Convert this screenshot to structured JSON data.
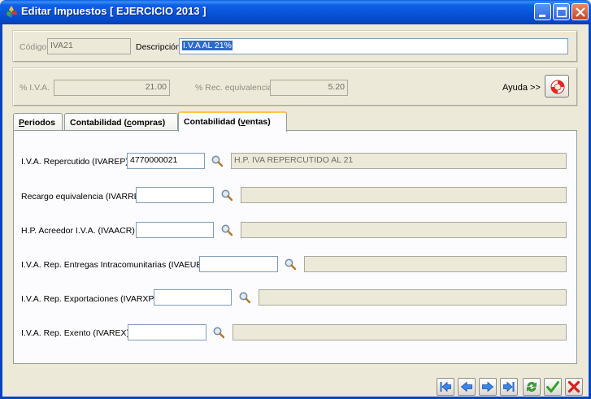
{
  "window": {
    "title": "Editar Impuestos [ EJERCICIO 2013 ]"
  },
  "header": {
    "codigo_label": "Código",
    "codigo_value": "IVA21",
    "descripcion_label": "Descripción",
    "descripcion_value": "I.V.A AL 21%"
  },
  "rates": {
    "iva_label": "% I.V.A.",
    "iva_value": "21.00",
    "rec_label": "% Rec. equivalencia",
    "rec_value": "5.20",
    "help_label": "Ayuda >>"
  },
  "tabs": [
    {
      "label_pre": "",
      "label_key": "P",
      "label_post": "eriodos"
    },
    {
      "label_pre": "Contabilidad (",
      "label_key": "c",
      "label_post": "ompras)"
    },
    {
      "label_pre": "Contabilidad (",
      "label_key": "v",
      "label_post": "entas)"
    }
  ],
  "accounts": [
    {
      "label": "I.V.A. Repercutido (IVAREP)",
      "code": "4770000021",
      "desc": "H.P. IVA REPERCUTIDO AL 21"
    },
    {
      "label": "Recargo equivalencia (IVARRE)",
      "code": "",
      "desc": ""
    },
    {
      "label": "H.P. Acreedor I.V.A. (IVAACR)",
      "code": "",
      "desc": ""
    },
    {
      "label": "I.V.A. Rep. Entregas Intracomunitarias (IVAEUE)",
      "code": "",
      "desc": ""
    },
    {
      "label": "I.V.A. Rep. Exportaciones (IVARXP)",
      "code": "",
      "desc": ""
    },
    {
      "label": "I.V.A. Rep. Exento (IVAREX)",
      "code": "",
      "desc": ""
    }
  ],
  "colors": {
    "titlebar": "#0853D8",
    "selection": "#316AC5",
    "tab_highlight": "#FFC73C"
  },
  "icons": {
    "app": "app-logo-icon",
    "lookup": "magnifier-icon",
    "help": "lifebuoy-icon",
    "first": "first-record-icon",
    "prev": "previous-record-icon",
    "next": "next-record-icon",
    "last": "last-record-icon",
    "refresh": "refresh-icon",
    "accept": "checkmark-icon",
    "cancel": "cancel-x-icon"
  }
}
